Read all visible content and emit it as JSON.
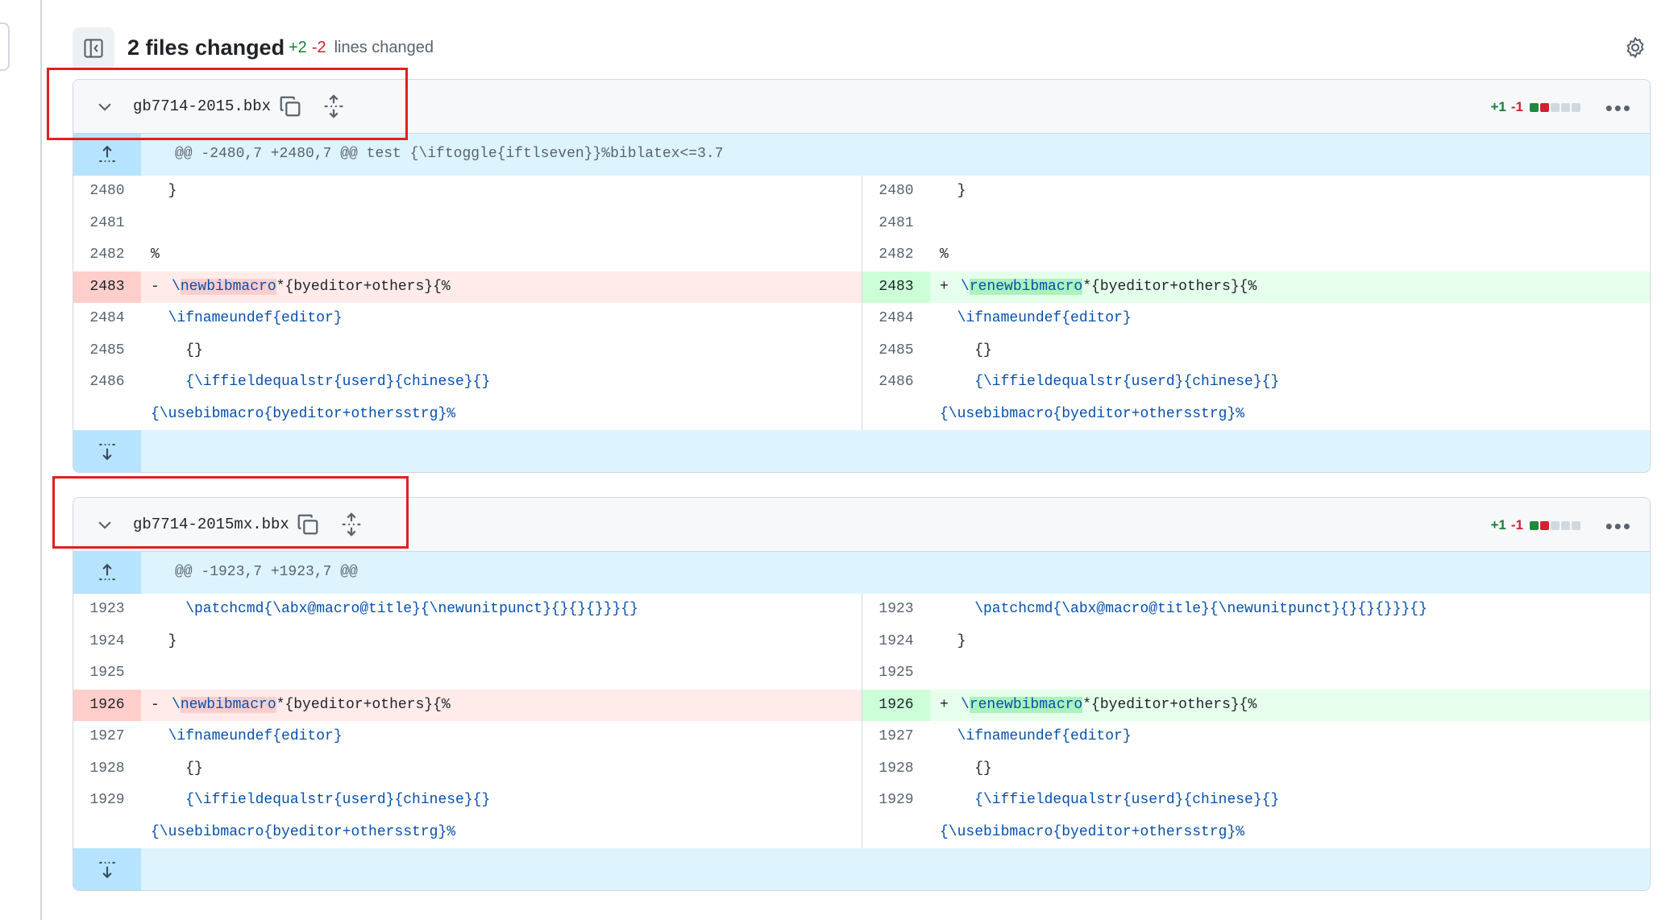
{
  "summary": {
    "title": "2 files changed",
    "additions": "+2",
    "deletions": "-2",
    "label": "lines changed"
  },
  "files": [
    {
      "name": "gb7714-2015.bbx",
      "additions": "+1",
      "deletions": "-1",
      "hunk_header": "@@ -2480,7 +2480,7 @@ test {\\iftoggle{iftlseven}}%biblatex<=3.7",
      "rows": [
        {
          "left_ln": "2480",
          "right_ln": "2480",
          "code": "  }"
        },
        {
          "left_ln": "2481",
          "right_ln": "2481",
          "code": ""
        },
        {
          "left_ln": "2482",
          "right_ln": "2482",
          "code": "%"
        },
        {
          "left_ln": "2483",
          "right_ln": "2483",
          "del_prefix": "\\",
          "del_word": "newbibmacro",
          "add_prefix": "\\",
          "add_word": "renewbibmacro",
          "rest": "*{byeditor+others}{%"
        },
        {
          "left_ln": "2484",
          "right_ln": "2484",
          "code": "  \\ifnameundef{editor}"
        },
        {
          "left_ln": "2485",
          "right_ln": "2485",
          "code": "    {}"
        },
        {
          "left_ln": "2486",
          "right_ln": "2486",
          "code": "    {\\iffieldequalstr{userd}{chinese}{}"
        },
        {
          "left_ln": "",
          "right_ln": "",
          "code": "{\\usebibmacro{byeditor+othersstrg}%"
        }
      ]
    },
    {
      "name": "gb7714-2015mx.bbx",
      "additions": "+1",
      "deletions": "-1",
      "hunk_header": "@@ -1923,7 +1923,7 @@",
      "rows": [
        {
          "left_ln": "1923",
          "right_ln": "1923",
          "code": "    \\patchcmd{\\abx@macro@title}{\\newunitpunct}{}{}{}}}{}"
        },
        {
          "left_ln": "1924",
          "right_ln": "1924",
          "code": "  }"
        },
        {
          "left_ln": "1925",
          "right_ln": "1925",
          "code": ""
        },
        {
          "left_ln": "1926",
          "right_ln": "1926",
          "del_prefix": "\\",
          "del_word": "newbibmacro",
          "add_prefix": "\\",
          "add_word": "renewbibmacro",
          "rest": "*{byeditor+others}{%"
        },
        {
          "left_ln": "1927",
          "right_ln": "1927",
          "code": "  \\ifnameundef{editor}"
        },
        {
          "left_ln": "1928",
          "right_ln": "1928",
          "code": "    {}"
        },
        {
          "left_ln": "1929",
          "right_ln": "1929",
          "code": "    {\\iffieldequalstr{userd}{chinese}{}"
        },
        {
          "left_ln": "",
          "right_ln": "",
          "code": "{\\usebibmacro{byeditor+othersstrg}%"
        }
      ]
    }
  ],
  "diff_signs": {
    "del": "-",
    "add": "+"
  },
  "icons": [
    "sidebar-toggle-icon",
    "gear-icon",
    "chevron-down-icon",
    "copy-icon",
    "expand-all-icon",
    "kebab-icon",
    "expand-up-icon",
    "expand-down-icon"
  ],
  "colors": {
    "annotation_box": "#e02020",
    "added": "#1a7f37",
    "deleted": "#cf222e"
  }
}
